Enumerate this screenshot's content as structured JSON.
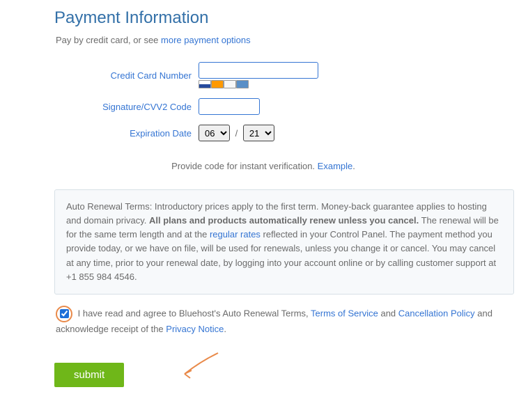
{
  "title": "Payment Information",
  "intro": {
    "prefix": "Pay by credit card, or see ",
    "link": "more payment options"
  },
  "labels": {
    "cc": "Credit Card Number",
    "cvv": "Signature/CVV2 Code",
    "exp": "Expiration Date"
  },
  "exp": {
    "month": "06",
    "year": "21"
  },
  "verify": {
    "text": "Provide code for instant verification. ",
    "example": "Example",
    "dot": "."
  },
  "terms": {
    "p1": "Auto Renewal Terms: Introductory prices apply to the first term. Money-back guarantee applies to hosting and domain privacy. ",
    "bold": "All plans and products automatically renew unless you cancel.",
    "p2": " The renewal will be for the same term length and at the ",
    "rates": "regular rates",
    "p3": " reflected in your Control Panel. The payment method you provide today, or we have on file, will be used for renewals, unless you change it or cancel. You may cancel at any time, prior to your renewal date, by logging into your account online or by calling customer support at +1 855 984 4546."
  },
  "agree": {
    "a1": " I have read and agree to Bluehost's Auto Renewal Terms, ",
    "tos": "Terms of Service",
    "and1": " and ",
    "cancel": "Cancellation Policy",
    "a2": " and acknowledge receipt of the ",
    "privacy": "Privacy Notice",
    "dot": "."
  },
  "submit": "submit"
}
